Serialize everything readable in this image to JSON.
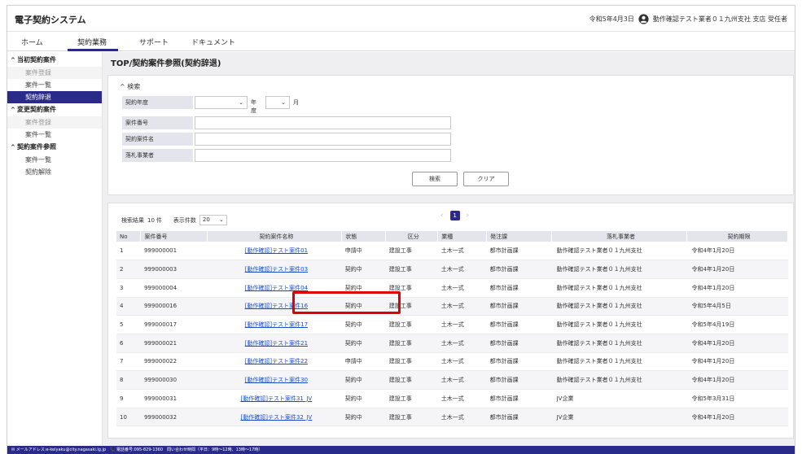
{
  "app": {
    "title": "電子契約システム"
  },
  "user": {
    "date": "令和5年4月3日",
    "name": "動作確認テスト業者０１九州支社 支店 受任者"
  },
  "nav": {
    "items": [
      "ホーム",
      "契約業務",
      "サポート",
      "ドキュメント"
    ],
    "active": "契約業務"
  },
  "sidebar": {
    "groups": [
      {
        "label": "当初契約案件",
        "items": [
          {
            "label": "案件登録",
            "state": "disabled"
          },
          {
            "label": "案件一覧",
            "state": "normal"
          },
          {
            "label": "契約辞退",
            "state": "active"
          }
        ]
      },
      {
        "label": "変更契約案件",
        "items": [
          {
            "label": "案件登録",
            "state": "disabled"
          },
          {
            "label": "案件一覧",
            "state": "normal"
          }
        ]
      },
      {
        "label": "契約案件参照",
        "items": [
          {
            "label": "案件一覧",
            "state": "normal"
          },
          {
            "label": "契約解除",
            "state": "normal"
          }
        ]
      }
    ]
  },
  "page": {
    "title": "TOP/契約案件参照(契約辞退)"
  },
  "search": {
    "toggle_label": "検索",
    "fields": {
      "fiscal_year_label": "契約年度",
      "year_unit": "年度",
      "month_unit": "月",
      "case_number_label": "案件番号",
      "case_name_label": "契約案件名",
      "bidder_label": "落札事業者"
    },
    "search_button": "検索",
    "clear_button": "クリア"
  },
  "results": {
    "count_label": "検索結果",
    "count_value": "10",
    "count_unit": "件",
    "page_size_label": "表示件数",
    "page_size_value": "20",
    "current_page": "1",
    "columns": [
      "No",
      "案件番号",
      "契約案件名称",
      "状態",
      "区分",
      "業種",
      "発注課",
      "落札事業者",
      "契約期限"
    ],
    "rows": [
      [
        "1",
        "999000001",
        "[動作確認]テスト案件01",
        "申請中",
        "建設工事",
        "土木一式",
        "都市計画課",
        "動作確認テスト業者０１九州支社",
        "令和4年1月20日"
      ],
      [
        "2",
        "999000003",
        "[動作確認]テスト案件03",
        "契約中",
        "建設工事",
        "土木一式",
        "都市計画課",
        "動作確認テスト業者０１九州支社",
        "令和4年1月20日"
      ],
      [
        "3",
        "999000004",
        "[動作確認]テスト案件04",
        "契約中",
        "建設工事",
        "土木一式",
        "都市計画課",
        "動作確認テスト業者０１九州支社",
        "令和4年1月20日"
      ],
      [
        "4",
        "999000016",
        "[動作確認]テスト案件16",
        "契約中",
        "建設工事",
        "土木一式",
        "都市計画課",
        "動作確認テスト業者０１九州支社",
        "令和5年4月5日"
      ],
      [
        "5",
        "999000017",
        "[動作確認]テスト案件17",
        "契約中",
        "建設工事",
        "土木一式",
        "都市計画課",
        "動作確認テスト業者０１九州支社",
        "令和5年4月19日"
      ],
      [
        "6",
        "999000021",
        "[動作確認]テスト案件21",
        "契約中",
        "建設工事",
        "土木一式",
        "都市計画課",
        "動作確認テスト業者０１九州支社",
        "令和4年1月20日"
      ],
      [
        "7",
        "999000022",
        "[動作確認]テスト案件22",
        "申請中",
        "建設工事",
        "土木一式",
        "都市計画課",
        "動作確認テスト業者０１九州支社",
        "令和4年1月20日"
      ],
      [
        "8",
        "999000030",
        "[動作確認]テスト案件30",
        "契約中",
        "建設工事",
        "土木一式",
        "都市計画課",
        "動作確認テスト業者０１九州支社",
        "令和4年1月20日"
      ],
      [
        "9",
        "999000031",
        "[動作確認]テスト案件31_JV",
        "契約中",
        "建設工事",
        "土木一式",
        "都市計画課",
        "JV企業",
        "令和5年3月31日"
      ],
      [
        "10",
        "999000032",
        "[動作確認]テスト案件32_JV",
        "契約中",
        "建設工事",
        "土木一式",
        "都市計画課",
        "JV企業",
        "令和4年1月20日"
      ]
    ]
  },
  "footer": {
    "text": "✉ メールアドレス:e-keiyaku@city.nagasaki.lg.jp　📞 電話番号:095-829-1360　問い合わせ時間（平日：9時〜12時、13時〜17時）"
  },
  "colors": {
    "brand": "#2a2a8a",
    "link": "#1a4fd0",
    "highlight": "#e00000",
    "label_bg": "#e4e4ec"
  },
  "icons": {
    "user": "user-circle-icon",
    "caret": "caret-up-icon",
    "select": "chevron-down-icon",
    "prev": "chevron-left-icon",
    "next": "chevron-right-icon"
  }
}
